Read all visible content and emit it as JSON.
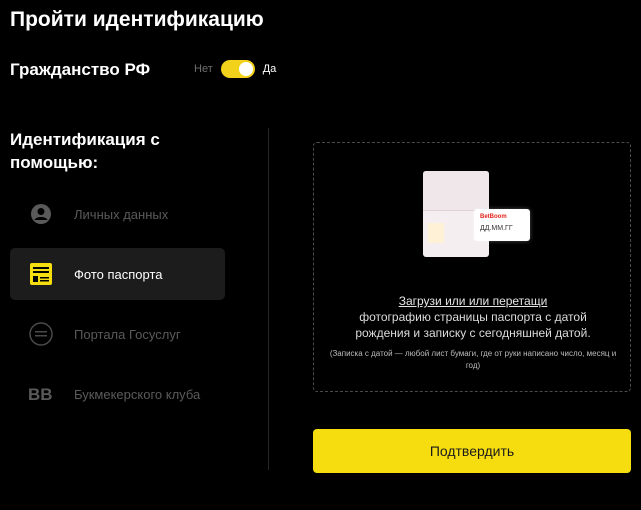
{
  "header": {
    "title": "Пройти идентификацию"
  },
  "citizenship": {
    "label": "Гражданство РФ",
    "toggle_off_label": "Нет",
    "toggle_on_label": "Да",
    "enabled": true
  },
  "identification": {
    "title": "Идентификация с помощью:",
    "methods": [
      {
        "label": "Личных данных",
        "icon": "user-icon",
        "active": false
      },
      {
        "label": "Фото паспорта",
        "icon": "passport-icon",
        "active": true
      },
      {
        "label": "Портала Госуслуг",
        "icon": "gosuslugi-icon",
        "active": false
      },
      {
        "label": "Букмекерского клуба",
        "icon": "bb-icon",
        "active": false
      }
    ]
  },
  "upload": {
    "link_text": "Загрузи или или перетащи",
    "line2": "фотографию страницы паспорта с датой",
    "line3": "рождения и записку с сегодняшней датой.",
    "hint": "(Записка с датой — любой лист бумаги, где от руки написано число, месяц и год)",
    "note_brand": "BetBoom",
    "note_date": "ДД.ММ.ГГ"
  },
  "confirm": {
    "label": "Подтвердить"
  },
  "colors": {
    "accent": "#f6dd10",
    "background": "#000000",
    "active_bg": "#1c1c1c"
  }
}
